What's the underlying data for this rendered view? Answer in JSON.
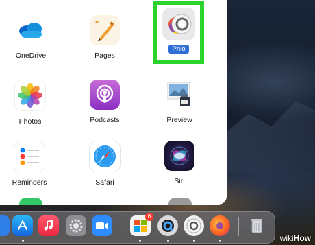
{
  "apps": [
    {
      "id": "onedrive",
      "label": "OneDrive"
    },
    {
      "id": "pages",
      "label": "Pages"
    },
    {
      "id": "phlo",
      "label": "Phlo",
      "selected": true
    },
    {
      "id": "photos",
      "label": "Photos"
    },
    {
      "id": "podcasts",
      "label": "Podcasts"
    },
    {
      "id": "preview",
      "label": "Preview"
    },
    {
      "id": "reminders",
      "label": "Reminders"
    },
    {
      "id": "safari",
      "label": "Safari"
    },
    {
      "id": "siri",
      "label": "Siri"
    }
  ],
  "dock": {
    "items": [
      "finder-icon",
      "app-store-icon",
      "music-icon",
      "system-preferences-icon",
      "zoom-icon",
      "microsoft-apps-icon",
      "quicktime-icon",
      "phlo-icon",
      "firefox-icon",
      "trash-icon"
    ],
    "microsoft_badge": "6"
  },
  "highlight_color": "#2cd32c",
  "selection_color": "#2f6ed6",
  "watermark": {
    "wiki": "wiki",
    "how": "How"
  }
}
